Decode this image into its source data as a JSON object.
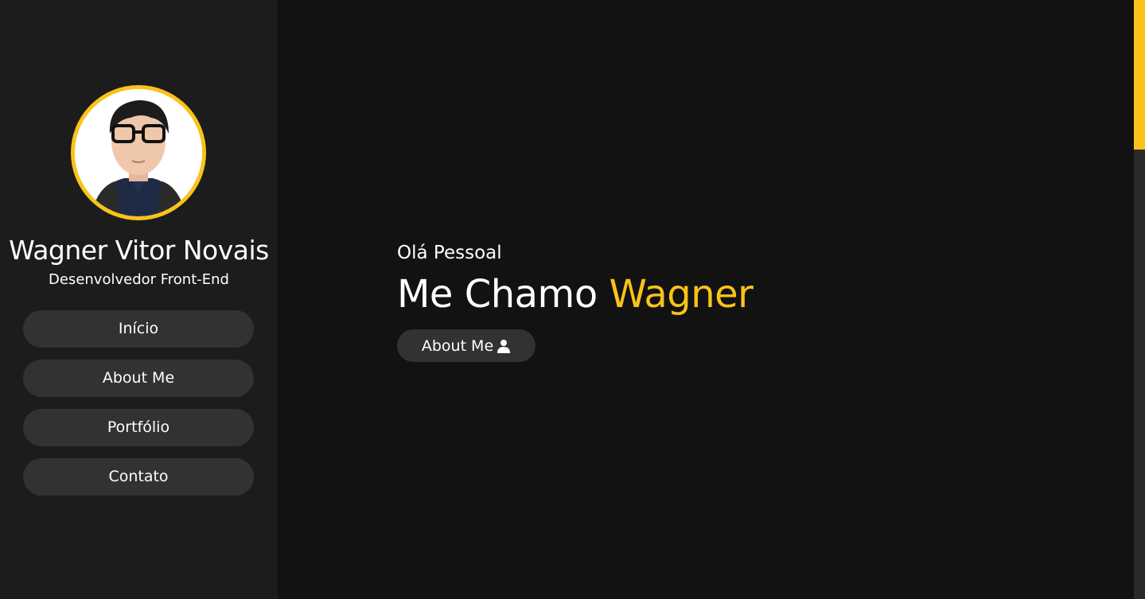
{
  "profile": {
    "name": "Wagner Vitor Novais",
    "role": "Desenvolvedor Front-End"
  },
  "nav": {
    "items": [
      {
        "label": "Início"
      },
      {
        "label": "About Me"
      },
      {
        "label": "Portfólio"
      },
      {
        "label": "Contato"
      }
    ]
  },
  "hero": {
    "greeting": "Olá Pessoal",
    "headline_prefix": "Me Chamo",
    "headline_name": "Wagner",
    "about_button_label": "About Me",
    "about_button_icon": "user-icon"
  },
  "colors": {
    "accent": "#f9c31a",
    "sidebar_bg": "#1c1c1c",
    "main_bg": "#121212",
    "button_bg": "#323232"
  }
}
